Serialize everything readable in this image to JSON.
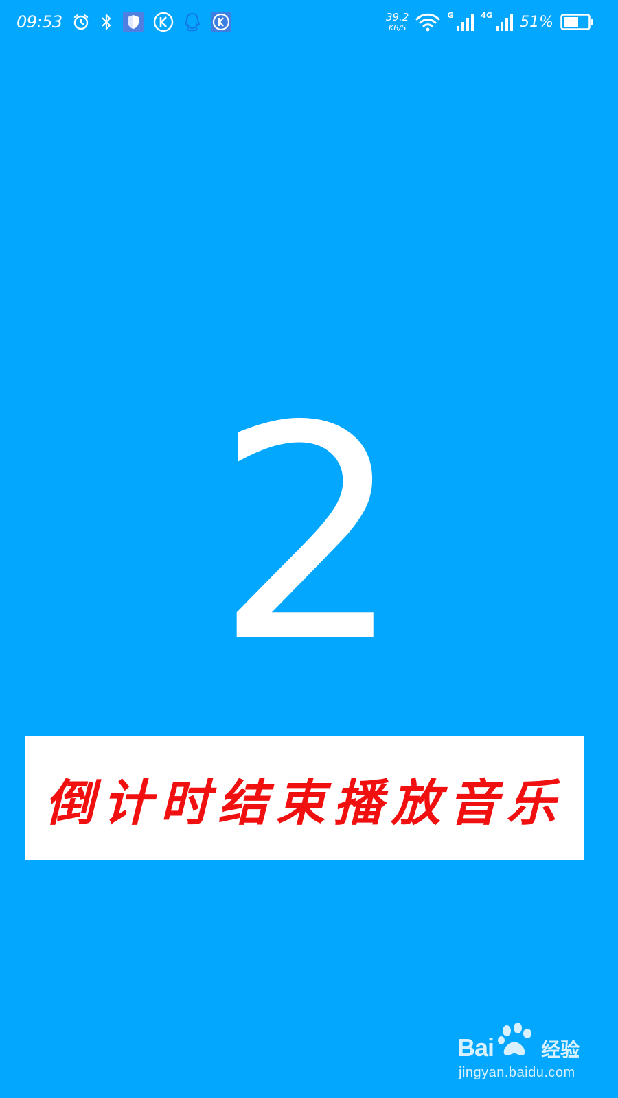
{
  "status_bar": {
    "time": "09:53",
    "net_speed_value": "39.2",
    "net_speed_unit": "KB/S",
    "sim1_label": "G",
    "sim2_label": "4G",
    "battery_percent": "51%",
    "left_icons": [
      "alarm-icon",
      "bluetooth-icon",
      "shield-icon",
      "k-app-icon",
      "qq-icon",
      "k-app-icon"
    ],
    "right_icons": [
      "wifi-icon",
      "signal-icon",
      "signal-icon",
      "battery-icon"
    ]
  },
  "countdown": {
    "value": "2"
  },
  "caption": {
    "text": "倒计时结束播放音乐"
  },
  "watermark": {
    "brand": "Bai",
    "brand_suffix": "经验",
    "url": "jingyan.baidu.com"
  },
  "colors": {
    "background": "#03a7fd",
    "caption_text": "#f01010",
    "caption_box": "#ffffff",
    "foreground": "#ffffff"
  }
}
